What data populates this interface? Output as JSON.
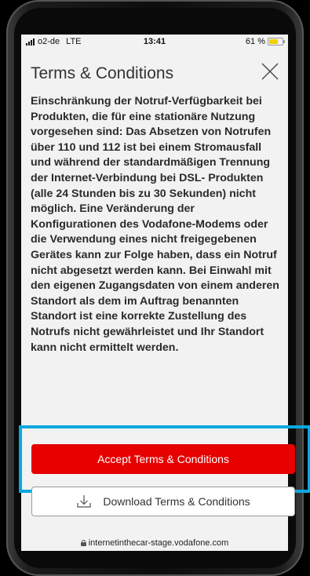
{
  "status_bar": {
    "carrier": "o2-de",
    "network": "LTE",
    "time": "13:41",
    "battery": "61 %",
    "battery_level": 0.61,
    "battery_color": "#f5d000"
  },
  "header": {
    "title": "Terms & Conditions",
    "close_icon": "close-icon"
  },
  "terms": {
    "text": "Einschränkung der Notruf-Verfügbarkeit bei Produkten, die für eine stationäre Nutzung vorgesehen sind: Das Absetzen von Notrufen über 110 und 112 ist bei einem Stromausfall und während der standardmäßigen Trennung der Internet-Verbindung bei DSL- Produkten (alle 24 Stunden bis zu 30 Sekunden) nicht möglich. Eine Veränderung der Konfigurationen des Vodafone-Modems oder die Verwendung eines nicht freigegebenen Gerätes kann zur Folge haben, dass ein Notruf nicht abgesetzt werden kann. Bei Einwahl mit den eigenen Zugangsdaten von einem anderen Standort als dem im Auftrag benannten Standort ist eine korrekte Zustellung des Notrufs nicht gewährleistet und Ihr Standort kann nicht ermittelt werden."
  },
  "actions": {
    "accept_label": "Accept Terms & Conditions",
    "download_label": "Download Terms & Conditions",
    "download_icon": "download-icon",
    "accent_color": "#e60000",
    "highlight_color": "#0aa8e0"
  },
  "browser": {
    "url": "internetinthecar-stage.vodafone.com",
    "lock_icon": "lock-icon"
  }
}
